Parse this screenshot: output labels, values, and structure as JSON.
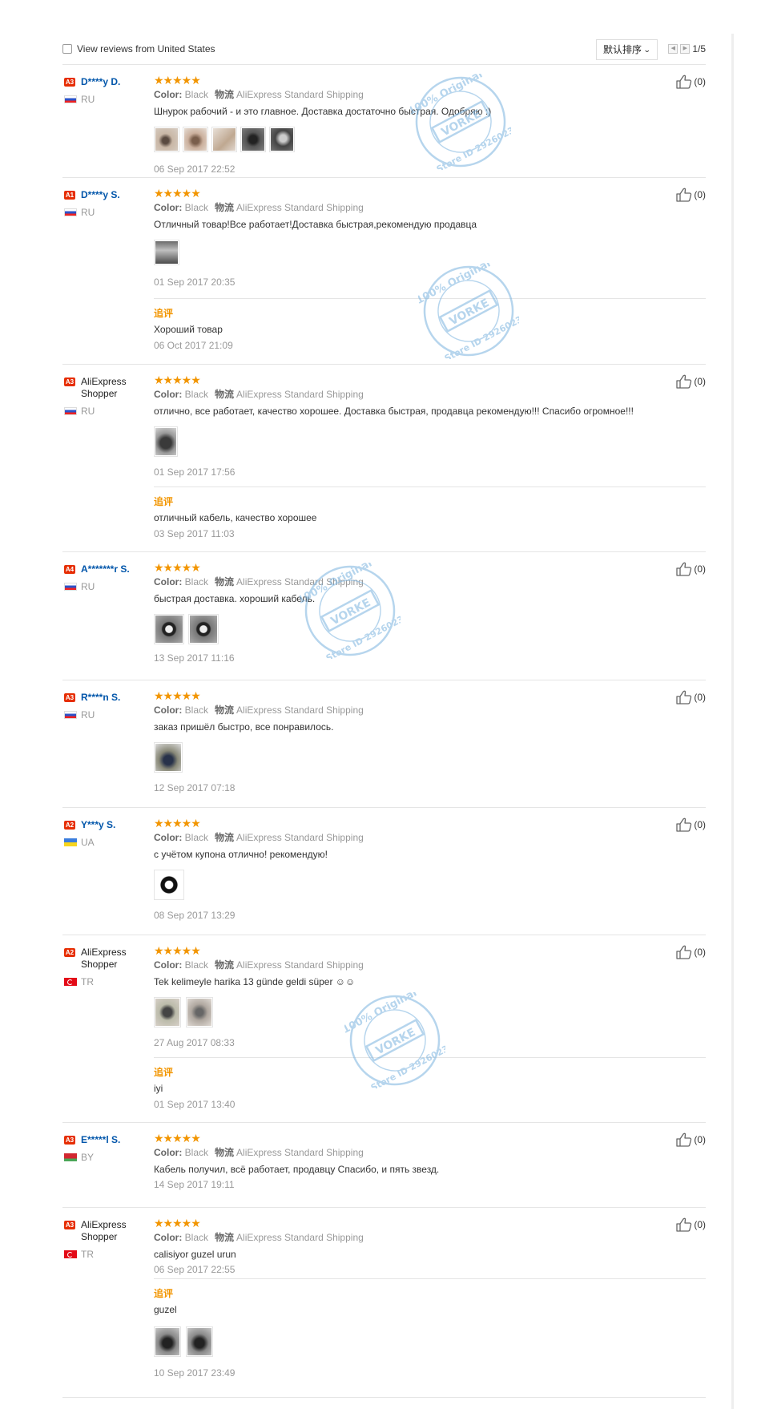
{
  "toolbar": {
    "filter_label": "View reviews from United States",
    "sort_label": "默认排序",
    "page_indicator": "1/5"
  },
  "attr_labels": {
    "color": "Color:",
    "shipping": "物流"
  },
  "followup_label": "追评",
  "watermark": {
    "line1": "100% Original",
    "line2": "VORKE",
    "line3": "Store ID 2926023"
  },
  "reviews": [
    {
      "level": "A3",
      "name": "D****y D.",
      "country": "RU",
      "color": "Black",
      "shipping": "AliExpress Standard Shipping",
      "text": "Шнурок рабочий - и это главное. Доставка достаточно быстрая. Одобряю :)",
      "date": "06 Sep 2017 22:52",
      "helpful": "(0)"
    },
    {
      "level": "A1",
      "name": "D****y S.",
      "country": "RU",
      "color": "Black",
      "shipping": "AliExpress Standard Shipping",
      "text": "Отличный товар!Все работает!Доставка быстрая,рекомендую продавца",
      "date": "01 Sep 2017 20:35",
      "helpful": "(0)",
      "followup": {
        "text": "Хороший товар",
        "date": "06 Oct 2017 21:09"
      }
    },
    {
      "level": "A3",
      "name": "AliExpress Shopper",
      "country": "RU",
      "color": "Black",
      "shipping": "AliExpress Standard Shipping",
      "text": "отлично, все работает, качество хорошее. Доставка быстрая, продавца рекомендую!!! Спасибо огромное!!!",
      "date": "01 Sep 2017 17:56",
      "helpful": "(0)",
      "followup": {
        "text": "отличный кабель, качество хорошее",
        "date": "03 Sep 2017 11:03"
      }
    },
    {
      "level": "A4",
      "name": "A*******r S.",
      "country": "RU",
      "color": "Black",
      "shipping": "AliExpress Standard Shipping",
      "text": "быстрая доставка. хороший кабель.",
      "date": "13 Sep 2017 11:16",
      "helpful": "(0)"
    },
    {
      "level": "A3",
      "name": "R****n S.",
      "country": "RU",
      "color": "Black",
      "shipping": "AliExpress Standard Shipping",
      "text": "заказ пришёл быстро, все понравилось.",
      "date": "12 Sep 2017 07:18",
      "helpful": "(0)"
    },
    {
      "level": "A2",
      "name": "Y***y S.",
      "country": "UA",
      "color": "Black",
      "shipping": "AliExpress Standard Shipping",
      "text": "с учётом купона отлично! рекомендую!",
      "date": "08 Sep 2017 13:29",
      "helpful": "(0)"
    },
    {
      "level": "A2",
      "name": "AliExpress Shopper",
      "country": "TR",
      "color": "Black",
      "shipping": "AliExpress Standard Shipping",
      "text": "Tek kelimeyle harika 13 günde geldi süper ☺☺",
      "date": "27 Aug 2017 08:33",
      "helpful": "(0)",
      "followup": {
        "text": "iyi",
        "date": "01 Sep 2017 13:40"
      }
    },
    {
      "level": "A3",
      "name": "E*****l S.",
      "country": "BY",
      "color": "Black",
      "shipping": "AliExpress Standard Shipping",
      "text": "Кабель получил, всё работает, продавцу Спасибо, и пять звезд.",
      "date": "14 Sep 2017 19:11",
      "helpful": "(0)"
    },
    {
      "level": "A3",
      "name": "AliExpress Shopper",
      "country": "TR",
      "color": "Black",
      "shipping": "AliExpress Standard Shipping",
      "text": "calisiyor guzel urun",
      "date": "06 Sep 2017 22:55",
      "helpful": "(0)",
      "followup": {
        "text": "guzel",
        "date": "10 Sep 2017 23:49"
      }
    }
  ]
}
